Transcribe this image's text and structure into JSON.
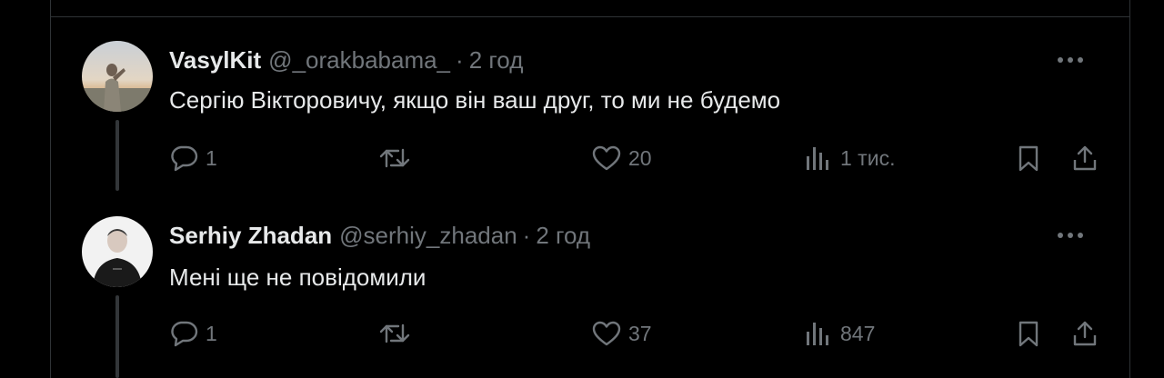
{
  "replies": [
    {
      "author_name": "VasylKit",
      "handle": "@_orakbabama_",
      "separator": "·",
      "time": "2 год",
      "text": "Сергію Вікторовичу, якщо він ваш друг, то ми не будемо",
      "actions": {
        "reply_count": "1",
        "retweet_count": "",
        "like_count": "20",
        "views_count": "1 тис."
      }
    },
    {
      "author_name": "Serhiy Zhadan",
      "handle": "@serhiy_zhadan",
      "separator": "·",
      "time": "2 год",
      "text": "Мені ще не повідомили",
      "actions": {
        "reply_count": "1",
        "retweet_count": "",
        "like_count": "37",
        "views_count": "847"
      }
    }
  ],
  "icons": {
    "more": "more-dots-icon",
    "reply": "reply-bubble-icon",
    "retweet": "retweet-arrows-icon",
    "like": "heart-icon",
    "views": "views-bars-icon",
    "bookmark": "bookmark-icon",
    "share": "share-upload-icon"
  },
  "colors": {
    "background": "#000000",
    "text_primary": "#e7e9ea",
    "text_secondary": "#71767b",
    "border": "#2f3336"
  }
}
